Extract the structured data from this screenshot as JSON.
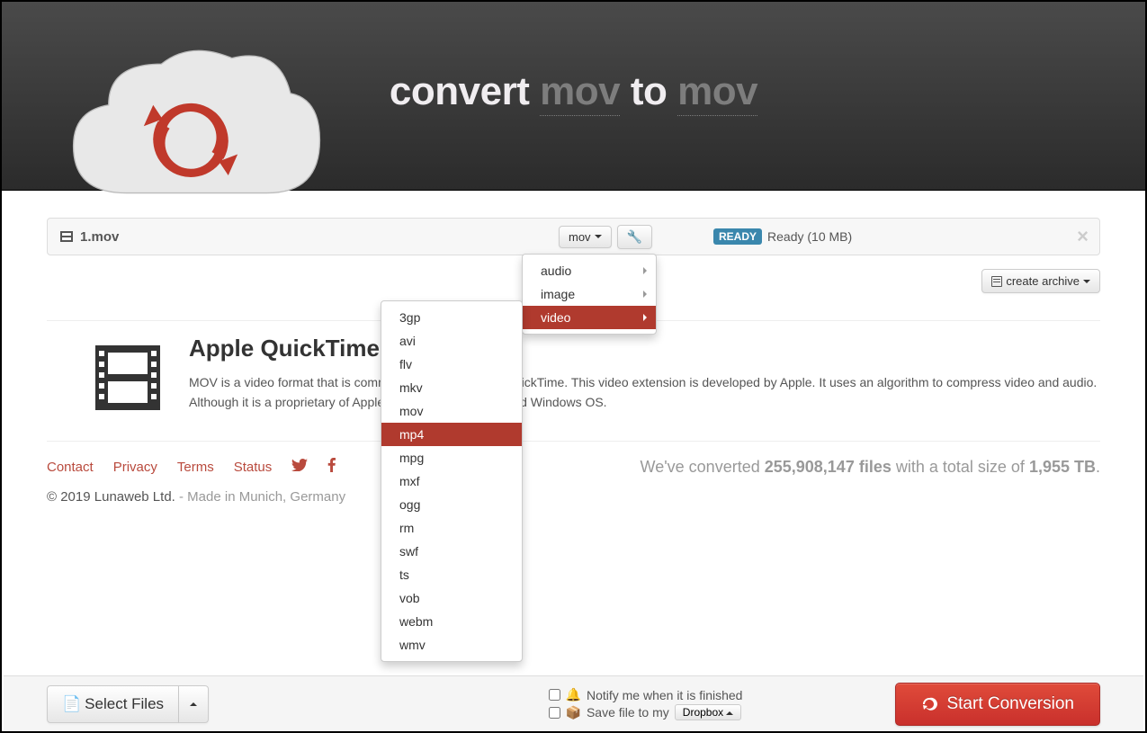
{
  "header": {
    "title_prefix": "convert",
    "title_from": "mov",
    "title_to_word": "to",
    "title_to": "mov"
  },
  "file": {
    "name": "1.mov",
    "format_selected": "mov",
    "status_badge": "READY",
    "status_text": "Ready (10 MB)"
  },
  "archive_btn": "create archive",
  "category_menu": {
    "items": [
      "audio",
      "image",
      "video"
    ],
    "active": "video"
  },
  "format_menu": {
    "items": [
      "3gp",
      "avi",
      "flv",
      "mkv",
      "mov",
      "mp4",
      "mpg",
      "mxf",
      "ogg",
      "rm",
      "swf",
      "ts",
      "vob",
      "webm",
      "wmv"
    ],
    "highlighted": "mp4"
  },
  "info": {
    "heading": "Apple QuickTime Movie",
    "body": "MOV is a video format that is commonly associated with QuickTime. This video extension is developed by Apple. It uses an algorithm to compress video and audio. Although it is a proprietary of Apple, it runs on both MAC and Windows OS."
  },
  "footer": {
    "links": [
      "Contact",
      "Privacy",
      "Terms",
      "Status"
    ],
    "stats_prefix": "We've converted ",
    "stats_files": "255,908,147 files",
    "stats_mid": " with a total size of ",
    "stats_size": "1,955 TB",
    "stats_suffix": ".",
    "copyright": "© 2019 Lunaweb Ltd.",
    "made_in": " - Made in Munich, Germany"
  },
  "bottom": {
    "select_files": "Select Files",
    "notify": "Notify me when it is finished",
    "save_to": "Save file to my",
    "dropbox": "Dropbox",
    "start": "Start Conversion"
  }
}
